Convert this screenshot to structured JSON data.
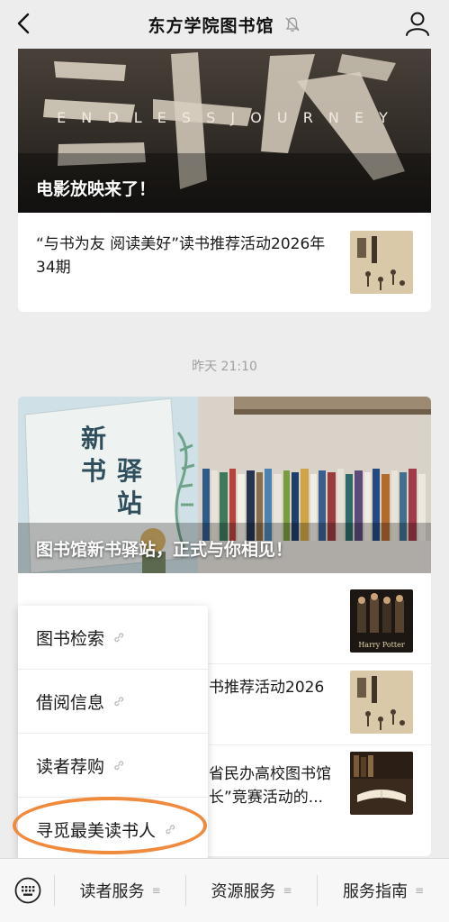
{
  "header": {
    "title": "东方学院图书馆"
  },
  "feed": {
    "card1": {
      "banner_title": "电影放映来了！",
      "banner_art_text": "E N D L E S S   J O U R N E Y",
      "article_text": "“与书为友 阅读美好”读书推荐活动2026年34期"
    },
    "timestamp": "昨天 21:10",
    "card2": {
      "banner_title": "图书馆新书驿站，正式与你相见！",
      "banner_sign": [
        "新",
        "书",
        "驿",
        "站"
      ],
      "rows": [
        {
          "text": ""
        },
        {
          "text": "书推荐活动2026"
        },
        {
          "text": "省民办高校图书馆\n长”竞赛活动的..."
        }
      ]
    }
  },
  "popup_menu": {
    "items": [
      "图书检索",
      "借阅信息",
      "读者荐购",
      "寻觅最美读书人"
    ]
  },
  "bottom_menu": {
    "items": [
      "读者服务",
      "资源服务",
      "服务指南"
    ]
  },
  "colors": {
    "highlight": "#f08a3c",
    "background": "#ededed"
  }
}
